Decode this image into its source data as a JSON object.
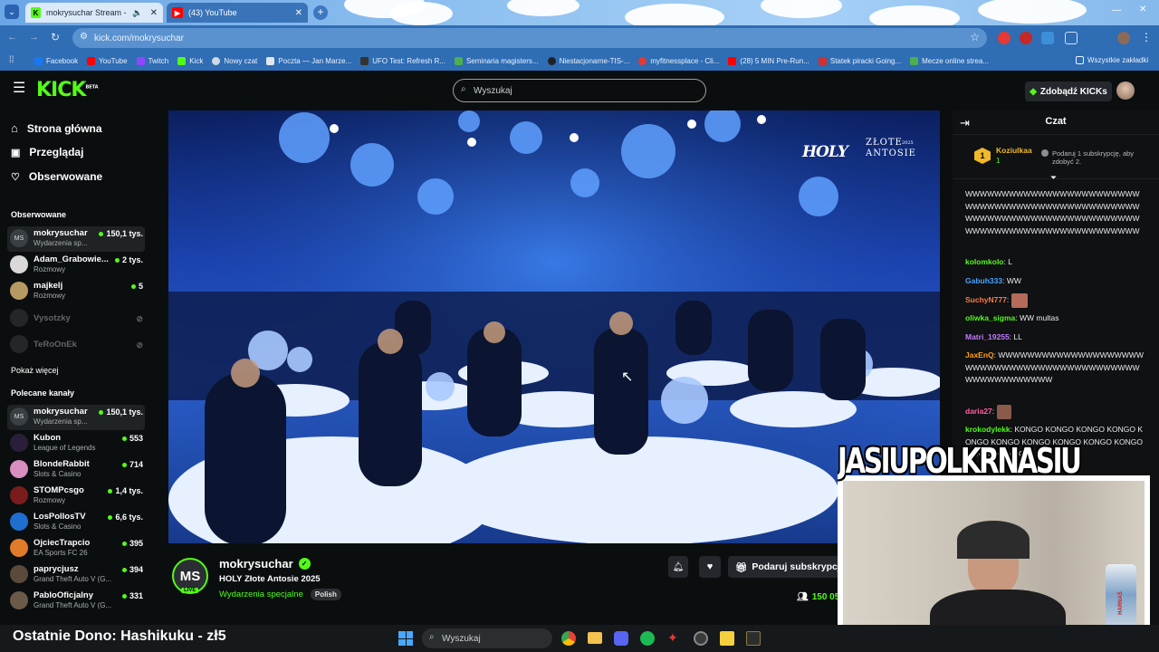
{
  "browser": {
    "tabs": [
      {
        "title": "mokrysuchar Stream - Watc",
        "active": true
      },
      {
        "title": "(43) YouTube",
        "active": false
      }
    ],
    "url": "kick.com/mokrysuchar",
    "bookmarks": [
      {
        "label": "Facebook",
        "color": "#1877f2"
      },
      {
        "label": "YouTube",
        "color": "#ff0000"
      },
      {
        "label": "Twitch",
        "color": "#9146ff"
      },
      {
        "label": "Kick",
        "color": "#53fc18"
      },
      {
        "label": "Nowy czat",
        "color": "#cfd8e3"
      },
      {
        "label": "Poczta — Jan Marze...",
        "color": "#e0e6ee"
      },
      {
        "label": "UFO Test: Refresh R...",
        "color": "#333333"
      },
      {
        "label": "Seminaria magisters...",
        "color": "#4caf50"
      },
      {
        "label": "Niestacjonarne-TIS-...",
        "color": "#222222"
      },
      {
        "label": "myfitnessplace - Cli...",
        "color": "#e53935"
      },
      {
        "label": "(28) 5 MIN Pre-Run...",
        "color": "#ff0000"
      },
      {
        "label": "Statek piracki Going...",
        "color": "#d32f2f"
      },
      {
        "label": "Mecze online strea...",
        "color": "#4caf50"
      }
    ],
    "bookmarks_all": "Wszystkie zakładki"
  },
  "header": {
    "logo": "KICK",
    "logo_beta": "BETA",
    "search_placeholder": "Wyszukaj",
    "kicks_button": "Zdobądź KICKs"
  },
  "sidebar": {
    "nav": [
      "Strona główna",
      "Przeglądaj",
      "Obserwowane"
    ],
    "followed_heading": "Obserwowane",
    "followed": [
      {
        "name": "mokrysuchar",
        "category": "Wydarzenia sp...",
        "viewers": "150,1 tys.",
        "live": true,
        "initials": "MS",
        "color": "#3a3f44"
      },
      {
        "name": "Adam_Grabowie...",
        "category": "Rozmowy",
        "viewers": "2 tys.",
        "live": true,
        "initials": "",
        "color": "#d9d9d9"
      },
      {
        "name": "majkelj",
        "category": "Rozmowy",
        "viewers": "5",
        "live": true,
        "initials": "",
        "color": "#b59a63"
      },
      {
        "name": "Vysotzky",
        "category": "",
        "viewers": "",
        "live": false,
        "initials": "",
        "color": "#555555"
      },
      {
        "name": "TeRoOnEk",
        "category": "",
        "viewers": "",
        "live": false,
        "initials": "",
        "color": "#555555"
      }
    ],
    "show_more": "Pokaż więcej",
    "recommended_heading": "Polecane kanały",
    "recommended": [
      {
        "name": "mokrysuchar",
        "category": "Wydarzenia sp...",
        "viewers": "150,1 tys.",
        "initials": "MS",
        "color": "#3a3f44"
      },
      {
        "name": "Kubon",
        "category": "League of Legends",
        "viewers": "553",
        "initials": "",
        "color": "#2a1f3a"
      },
      {
        "name": "BlondeRabbit",
        "category": "Slots & Casino",
        "viewers": "714",
        "initials": "",
        "color": "#d88fbf"
      },
      {
        "name": "STOMPcsgo",
        "category": "Rozmowy",
        "viewers": "1,4 tys.",
        "initials": "",
        "color": "#7a1c1c"
      },
      {
        "name": "LosPollosTV",
        "category": "Slots & Casino",
        "viewers": "6,6 tys.",
        "initials": "",
        "color": "#1f6fd1"
      },
      {
        "name": "OjciecTrapcio",
        "category": "EA Sports FC 26",
        "viewers": "395",
        "initials": "",
        "color": "#e07b2a"
      },
      {
        "name": "paprycjusz",
        "category": "Grand Theft Auto V (G...",
        "viewers": "394",
        "initials": "",
        "color": "#5a4a3a"
      },
      {
        "name": "PabloOficjalny",
        "category": "Grand Theft Auto V (G...",
        "viewers": "331",
        "initials": "",
        "color": "#6b5a48"
      }
    ]
  },
  "stream": {
    "overlay_logo": "HOLY",
    "overlay_title": "ZŁOTE ANTOSIE",
    "overlay_year": "2025",
    "channel": "mokrysuchar",
    "initials": "MS",
    "live_badge": "LIVE",
    "title": "HOLY Złote Antosie 2025",
    "category": "Wydarzenia specjalne",
    "language": "Polish",
    "gift_button": "Podaruj subskrypcje",
    "viewers": "150 05"
  },
  "chat": {
    "title": "Czat",
    "pinned_user": "Koziulkaa",
    "pinned_rank": "1",
    "pinned_count": "1",
    "gift_hint": "Podaruj 1 subskrypcję, aby zdobyć 2.",
    "messages": [
      {
        "user": "",
        "color": "#ffffff",
        "text": "WWWWWWWWWWWWWWWWWWWWWWWWWWWWWWWWWWWWWWWWWWWWWWWWWWWWWWWWWWWWWWWWWWWWWWWWWWWWWWWWWWWWWWWWWWWWWWWW"
      },
      {
        "user": "kolomkolo",
        "color": "#53fc18",
        "text": "L"
      },
      {
        "user": "Gabuh333",
        "color": "#4aa3ff",
        "text": "WW"
      },
      {
        "user": "SuchyN777",
        "color": "#ff7a3d",
        "text": ""
      },
      {
        "user": "oliwka_sigma",
        "color": "#53fc18",
        "text": "WW multas"
      },
      {
        "user": "Matri_19255",
        "color": "#c27bff",
        "text": "LL"
      },
      {
        "user": "JaxEnQ",
        "color": "#ff9f1a",
        "text": "WWWWWWWWWWWWWWWWWWWWWWWWWWWWWWWWWWWWWWWWWWWWWWWWWWWWWWWW"
      },
      {
        "user": "daria27",
        "color": "#ff5fa2",
        "text": ""
      },
      {
        "user": "krokodylekk",
        "color": "#53fc18",
        "text": "KONGO KONGO KONGO KONGO KONGO KONGO KONGO KONGO KONGO KONGO KONGO KONGO"
      }
    ]
  },
  "webcam": {
    "name_overlay": "JASIUPOLKRNASIU",
    "can_label": "HARNAŚ"
  },
  "donation": {
    "text": "Ostatnie Dono: Hashikuku - zł5"
  },
  "taskbar": {
    "search_placeholder": "Wyszukaj"
  }
}
